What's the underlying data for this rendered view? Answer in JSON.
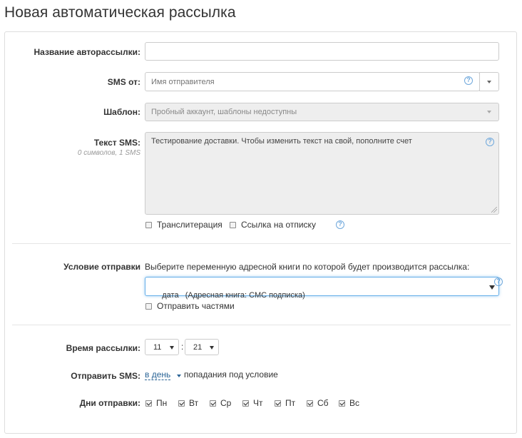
{
  "page": {
    "title": "Новая автоматическая рассылка"
  },
  "form": {
    "name": {
      "label": "Название авторассылки:",
      "value": ""
    },
    "sms_from": {
      "label": "SMS от:",
      "placeholder": "Имя отправителя",
      "help": "?"
    },
    "template": {
      "label": "Шаблон:",
      "value": "Пробный аккаунт, шаблоны недоступны"
    },
    "sms_text": {
      "label": "Текст SMS:",
      "counter": "0 символов, 1 SMS",
      "value": "Тестирование доставки. Чтобы изменить текст на свой, пополните счет",
      "help": "?"
    },
    "options": {
      "transliteration": {
        "label": "Транслитерация",
        "checked": false
      },
      "unsubscribe_link": {
        "label": "Ссылка на отписку",
        "checked": false
      },
      "help": "?"
    },
    "condition": {
      "label": "Условие отправки",
      "hint": "Выберите переменную адресной книги по которой будет производится рассылка:",
      "selected": "дата   (Адресная книга: СМС подписка)",
      "help": "?",
      "send_parts": {
        "label": "Отправить частями",
        "checked": false
      }
    },
    "send_time": {
      "label": "Время рассылки:",
      "hour": "11",
      "separator": ":",
      "minute": "21"
    },
    "send_sms": {
      "label": "Отправить SMS:",
      "frequency": "в день",
      "suffix": "попадания под условие"
    },
    "send_days": {
      "label": "Дни отправки:",
      "days": [
        {
          "label": "Пн",
          "checked": true
        },
        {
          "label": "Вт",
          "checked": true
        },
        {
          "label": "Ср",
          "checked": true
        },
        {
          "label": "Чт",
          "checked": true
        },
        {
          "label": "Пт",
          "checked": true
        },
        {
          "label": "Сб",
          "checked": true
        },
        {
          "label": "Вс",
          "checked": true
        }
      ]
    }
  },
  "colors": {
    "link": "#2a6496",
    "focus_border": "#66afe9",
    "help": "#6fa8dc",
    "disabled_bg": "#eeeeee"
  }
}
